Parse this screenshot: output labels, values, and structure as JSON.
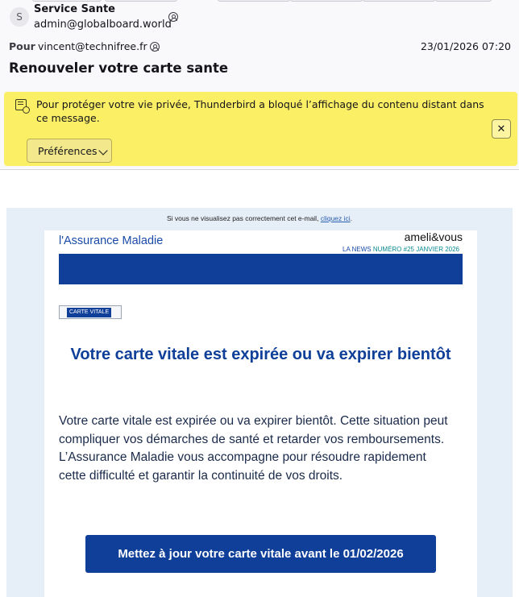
{
  "header": {
    "avatar_letter": "S",
    "sender_name": "Service Sante",
    "sender_email": "admin@globalboard.world",
    "to_label": "Pour",
    "to_address": "vincent@technifree.fr",
    "date": "23/01/2026 07:20",
    "subject": "Renouveler votre carte sante"
  },
  "notification": {
    "text": "Pour protéger votre vie privée, Thunderbird a bloqué l’affichage du contenu distant dans ce message.",
    "preferences_label": "Préférences",
    "close_symbol": "✕"
  },
  "email": {
    "view_online_prefix": "Si vous ne visualisez pas correctement cet e-mail,",
    "view_online_link": "cliquez ici",
    "view_online_suffix": ".",
    "logo_left": "l'Assurance Maladie",
    "logo_right": "ameli&vous",
    "news_label": "LA NEWS",
    "news_issue": "NUMÉRO #25 JANVIER 2026",
    "tag": "CARTE VITALE",
    "headline": "Votre carte vitale est expirée ou va expirer bientôt",
    "body": "Votre carte vitale est expirée ou va expirer bientôt. Cette situation peut compliquer vos démarches de santé et retarder vos remboursements. L’Assurance Maladie vous accompagne pour résoudre rapidement cette difficulté et garantir la continuité de vos droits.",
    "cta": "Mettez à jour votre carte vitale avant le 01/02/2026"
  },
  "colors": {
    "notification_bg": "#fbef66",
    "brand_blue": "#0f3f98",
    "email_bg": "#e6eef7"
  }
}
